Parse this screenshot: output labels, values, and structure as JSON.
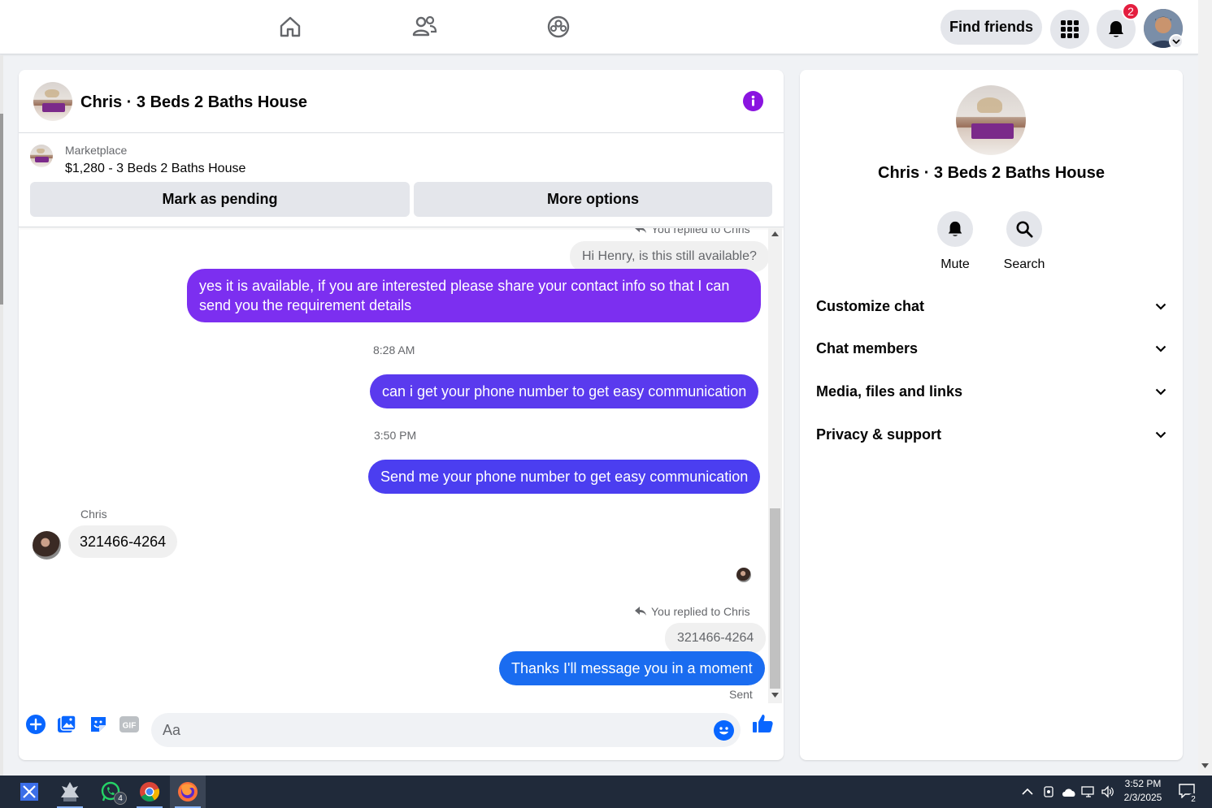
{
  "topbar": {
    "find_friends_label": "Find friends",
    "notification_count": "2",
    "icons": [
      "home-icon",
      "friends-icon",
      "groups-icon",
      "menu-grid-icon",
      "bell-icon",
      "account-avatar"
    ]
  },
  "chat": {
    "title": "Chris · 3 Beds 2 Baths House",
    "marketplace_label": "Marketplace",
    "listing": "$1,280 - 3 Beds 2 Baths House",
    "mark_pending_label": "Mark as pending",
    "more_options_label": "More options",
    "messages": {
      "reply_note_1": "You replied to Chris",
      "quoted_1": "Hi Henry, is this still available?",
      "msg_1": "yes it is available, if you are interested please share your contact info so that I can send you the requirement details",
      "time_1": "8:28 AM",
      "msg_2": "can i get your phone number to get easy communication",
      "time_2": "3:50 PM",
      "msg_3": "Send me your phone number to get easy communication",
      "sender_chris": "Chris",
      "msg_4": "321466-4264",
      "reply_note_2": "You replied to Chris",
      "quoted_2": "321466-4264",
      "msg_5": "Thanks I'll message you in a moment",
      "status": "Sent"
    },
    "composer": {
      "placeholder": "Aa",
      "value": ""
    }
  },
  "details": {
    "title": "Chris · 3 Beds 2 Baths House",
    "mute_label": "Mute",
    "search_label": "Search",
    "sections": [
      "Customize chat",
      "Chat members",
      "Media, files and links",
      "Privacy & support"
    ]
  },
  "taskbar": {
    "time": "3:52 PM",
    "date": "2/3/2025",
    "whatsapp_badge": "4",
    "action_center_badge": "2"
  },
  "colors": {
    "accent_purple": "#7c2ff0",
    "accent_blue": "#1a6cf0",
    "facebook_blue": "#0866ff",
    "badge_red": "#e41e3f"
  }
}
